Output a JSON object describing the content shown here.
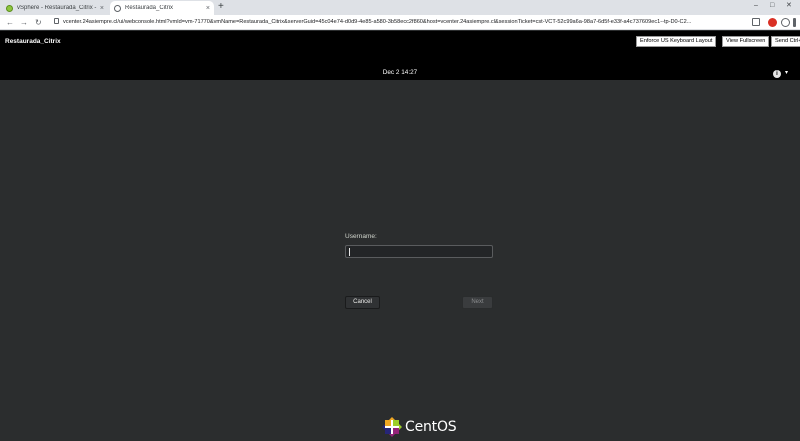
{
  "browser": {
    "tabs": [
      {
        "title": "vSphere - Restaurada_Citrix - Su",
        "close": "×"
      },
      {
        "title": "Restaurada_Citrix",
        "close": "×"
      }
    ],
    "new_tab": "+",
    "window": {
      "minimize": "–",
      "maximize": "□",
      "close": "✕"
    },
    "nav": {
      "back": "←",
      "forward": "→",
      "reload": "↻"
    },
    "url": "vcenter.24asiempre.cl/ui/webconsole.html?vmId=vm-71770&vmName=Restaurada_Citrix&serverGuid=45c04e74-d0d9-4e85-a580-3b58ecc2f860&host=vcenter.24asiempre.cl&sessionTicket=cst-VCT-52c99a6a-98a7-6d5f-e33f-a4c737609ec1--tp-D0-C2...",
    "extensions": [
      "star-icon",
      "pdf-icon",
      "account-icon",
      "menu-icon"
    ]
  },
  "console": {
    "vm_name": "Restaurada_Citrix",
    "buttons": {
      "keyboard": "Enforce US Keyboard Layout",
      "fullscreen": "View Fullscreen",
      "ctrl_alt_del": "Send Ctrl+Alt+Delete"
    }
  },
  "gnome": {
    "clock": "Dec 2  14:27",
    "accessibility_glyph": "i",
    "menu_caret": "▾"
  },
  "login": {
    "username_label": "Username:",
    "username_value": "",
    "cancel_label": "Cancel",
    "next_label": "Next"
  },
  "branding": {
    "logo_text": "CentOS"
  },
  "colors": {
    "background": "#2b2d2e",
    "top_bar": "#000000",
    "accent_active_tab": "#ffffff"
  }
}
